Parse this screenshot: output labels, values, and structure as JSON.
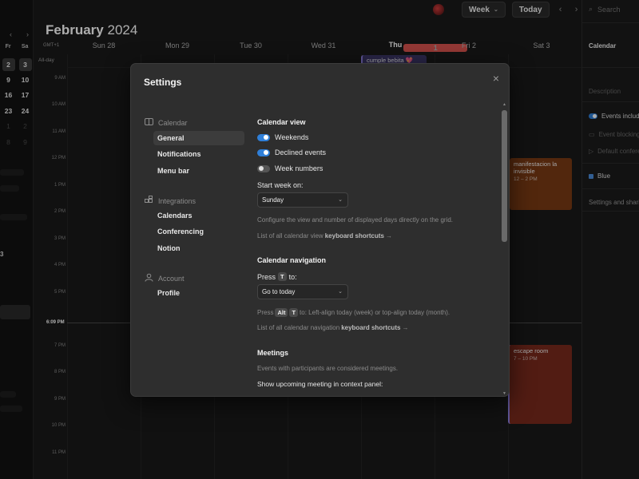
{
  "mini_calendar": {
    "nav_prev": "‹",
    "nav_next": "›",
    "weekday_headers": [
      "Fr",
      "Sa"
    ],
    "rows": [
      [
        "2",
        "3"
      ],
      [
        "9",
        "10"
      ],
      [
        "16",
        "17"
      ],
      [
        "23",
        "24"
      ],
      [
        "1",
        "2"
      ],
      [
        "8",
        "9"
      ]
    ],
    "stray_digit": "3"
  },
  "header": {
    "month": "February",
    "year": "2024",
    "view_label": "Week",
    "today_button": "Today",
    "prev": "‹",
    "next": "›"
  },
  "week": {
    "timezone": "GMT+1",
    "all_day": "All-day",
    "days": [
      {
        "label": "Sun 28"
      },
      {
        "label": "Mon 29"
      },
      {
        "label": "Tue 30"
      },
      {
        "label": "Wed 31"
      },
      {
        "label": "Thu",
        "badge": "1",
        "is_today": true
      },
      {
        "label": "Fri 2"
      },
      {
        "label": "Sat 3"
      }
    ],
    "hours": [
      "9 AM",
      "10 AM",
      "11 AM",
      "12 PM",
      "1 PM",
      "2 PM",
      "3 PM",
      "4 PM",
      "5 PM",
      "6:09 PM",
      "7 PM",
      "8 PM",
      "9 PM",
      "10 PM",
      "11 PM"
    ],
    "current_time": "6:09 PM"
  },
  "events": [
    {
      "title": "cumple bebita 💖",
      "time": "",
      "color": "#3b3566"
    },
    {
      "title": "manifestacion la invisible",
      "time": "12 – 2 PM",
      "color": "#7a3a14"
    },
    {
      "title": "escape room",
      "time": "7 – 10 PM",
      "color": "#7a2a1c"
    }
  ],
  "right_panel": {
    "search_placeholder": "Search",
    "calendar_label": "Calendar",
    "description_placeholder": "Description",
    "events_included": "Events included",
    "event_blocking": "Event blocking",
    "default_conferencing": "Default conferencing",
    "color_name": "Blue",
    "color_hex": "#4a8bd8",
    "settings_sharing": "Settings and sharing"
  },
  "settings": {
    "title": "Settings",
    "close": "×",
    "nav": {
      "calendar_section": "Calendar",
      "general": "General",
      "notifications": "Notifications",
      "menu_bar": "Menu bar",
      "integrations_section": "Integrations",
      "calendars": "Calendars",
      "conferencing": "Conferencing",
      "notion": "Notion",
      "account_section": "Account",
      "profile": "Profile"
    },
    "calendar_view": {
      "heading": "Calendar view",
      "weekends": {
        "label": "Weekends",
        "on": true
      },
      "declined": {
        "label": "Declined events",
        "on": true
      },
      "week_numbers": {
        "label": "Week numbers",
        "on": false
      },
      "start_week_label": "Start week on:",
      "start_week_value": "Sunday",
      "configure_text": "Configure the view and number of displayed days directly on the grid.",
      "shortcuts_prefix": "List of all calendar view",
      "shortcuts_bold": "keyboard shortcuts",
      "arrow": "→"
    },
    "calendar_navigation": {
      "heading": "Calendar navigation",
      "press": "Press",
      "key_t": "T",
      "to": "to:",
      "go_to_value": "Go to today",
      "alt_press": "Press",
      "key_alt": "Alt",
      "alt_rest": "to: Left-align today (week) or top-align today (month).",
      "shortcuts_prefix": "List of all calendar navigation",
      "shortcuts_bold": "keyboard shortcuts",
      "arrow": "→"
    },
    "meetings": {
      "heading": "Meetings",
      "description": "Events with participants are considered meetings.",
      "show_upcoming": "Show upcoming meeting in context panel:"
    }
  }
}
